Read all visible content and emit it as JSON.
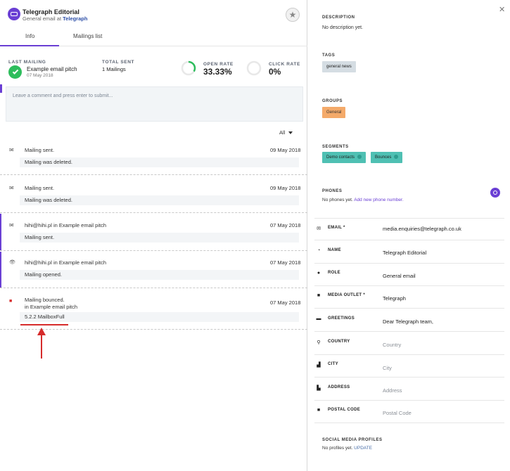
{
  "header": {
    "title": "Telegraph Editorial",
    "subtitle_prefix": "General email at",
    "subtitle_outlet": "Telegraph",
    "star_icon": "star-icon"
  },
  "tabs": [
    {
      "label": "Info",
      "active": true
    },
    {
      "label": "Mailings list",
      "active": false
    }
  ],
  "stats": {
    "last_mailing_caption": "LAST MAILING",
    "last_mailing_name": "Example email pitch",
    "last_mailing_date": "07 May 2018",
    "total_sent_caption": "TOTAL SENT",
    "total_sent_value": "1 Mailings",
    "open_rate_caption": "OPEN RATE",
    "open_rate_value": "33.33%",
    "open_rate_fraction": 0.3333,
    "click_rate_caption": "CLICK RATE",
    "click_rate_value": "0%",
    "click_rate_fraction": 0
  },
  "comment": {
    "placeholder": "Leave a comment and press enter to submit..."
  },
  "filter": {
    "selected": "All"
  },
  "activities": [
    {
      "icon": "✉",
      "icon_name": "mail-icon",
      "title": "Mailing sent.",
      "subtitle": "",
      "date": "09 May 2018",
      "body": "Mailing was deleted."
    },
    {
      "icon": "✉",
      "icon_name": "mail-icon",
      "title": "Mailing sent.",
      "subtitle": "",
      "date": "09 May 2018",
      "body": "Mailing was deleted."
    },
    {
      "icon": "✉",
      "icon_name": "mail-icon",
      "title": "hihi@hihi.pl in Example email pitch",
      "subtitle": "",
      "date": "07 May 2018",
      "body": "Mailing sent."
    },
    {
      "icon": "👁",
      "icon_name": "eye-icon",
      "title": "hihi@hihi.pl in Example email pitch",
      "subtitle": "",
      "date": "07 May 2018",
      "body": "Mailing opened."
    },
    {
      "icon": "■",
      "icon_name": "bounce-icon",
      "title": "Mailing bounced.",
      "subtitle": "in Example email pitch",
      "date": "07 May 2018",
      "body": "5.2.2 MailboxFull"
    }
  ],
  "right": {
    "description_caption": "DESCRIPTION",
    "description_text": "No description yet.",
    "tags_caption": "TAGS",
    "tags": [
      "general news"
    ],
    "groups_caption": "GROUPS",
    "groups": [
      "General"
    ],
    "segments_caption": "SEGMENTS",
    "segments": [
      "Demo contacts",
      "Bounces"
    ],
    "phones_caption": "PHONES",
    "phones_text": "No phones yet.",
    "phones_link": "Add new phone number.",
    "fields": [
      {
        "icon": "✉",
        "icon_name": "email-icon",
        "label": "EMAIL *",
        "value": "media.enquiries@telegraph.co.uk",
        "placeholder": false
      },
      {
        "icon": "◔",
        "icon_name": "name-icon",
        "label": "NAME",
        "value": "Telegraph Editorial",
        "placeholder": false
      },
      {
        "icon": "●",
        "icon_name": "role-icon",
        "label": "ROLE",
        "value": "General email",
        "placeholder": false
      },
      {
        "icon": "■",
        "icon_name": "media-outlet-icon",
        "label": "MEDIA OUTLET *",
        "value": "Telegraph",
        "placeholder": false
      },
      {
        "icon": "▬",
        "icon_name": "greetings-icon",
        "label": "GREETINGS",
        "value": "Dear Telegraph team,",
        "placeholder": false
      },
      {
        "icon": "⚲",
        "icon_name": "country-icon",
        "label": "COUNTRY",
        "value": "Country",
        "placeholder": true
      },
      {
        "icon": "▟",
        "icon_name": "city-icon",
        "label": "CITY",
        "value": "City",
        "placeholder": true
      },
      {
        "icon": "▙",
        "icon_name": "address-icon",
        "label": "ADDRESS",
        "value": "Address",
        "placeholder": true
      },
      {
        "icon": "■",
        "icon_name": "postal-code-icon",
        "label": "POSTAL CODE",
        "value": "Postal Code",
        "placeholder": true
      }
    ],
    "social_caption": "SOCIAL MEDIA PROFILES",
    "social_text": "No profiles yet.",
    "social_link": "UPDATE"
  },
  "colors": {
    "accent": "#6a3fd4",
    "success": "#2dbd5c",
    "tag": "#d5dde3",
    "group": "#f4aa6a",
    "segment": "#4fc0b3",
    "annotation": "#d62b2b"
  }
}
